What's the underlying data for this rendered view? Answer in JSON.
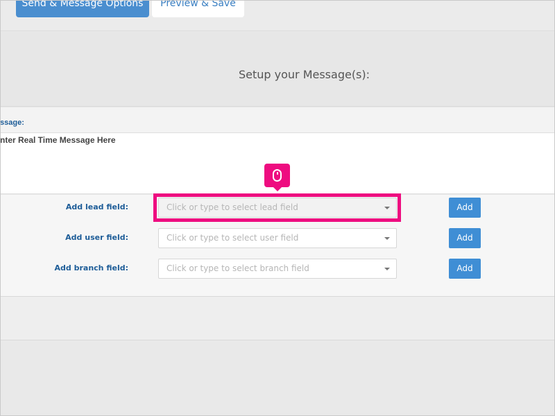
{
  "tabs": {
    "send_options": "Send & Message Options",
    "preview_save": "Preview & Save"
  },
  "setup": {
    "title": "Setup your Message(s):"
  },
  "message": {
    "label": "ssage:",
    "textarea_value": "nter Real Time Message Here"
  },
  "fields": {
    "lead": {
      "label": "Add lead field:",
      "placeholder": "Click or type to select lead field",
      "button": "Add"
    },
    "user": {
      "label": "Add user field:",
      "placeholder": "Click or type to select user field",
      "button": "Add"
    },
    "branch": {
      "label": "Add branch field:",
      "placeholder": "Click or type to select branch field",
      "button": "Add"
    }
  },
  "highlight": {
    "color": "#ee0c80",
    "icon": "mouse-icon"
  },
  "colors": {
    "primary_button": "#3f8ed5",
    "label_blue": "#1e5d98"
  }
}
